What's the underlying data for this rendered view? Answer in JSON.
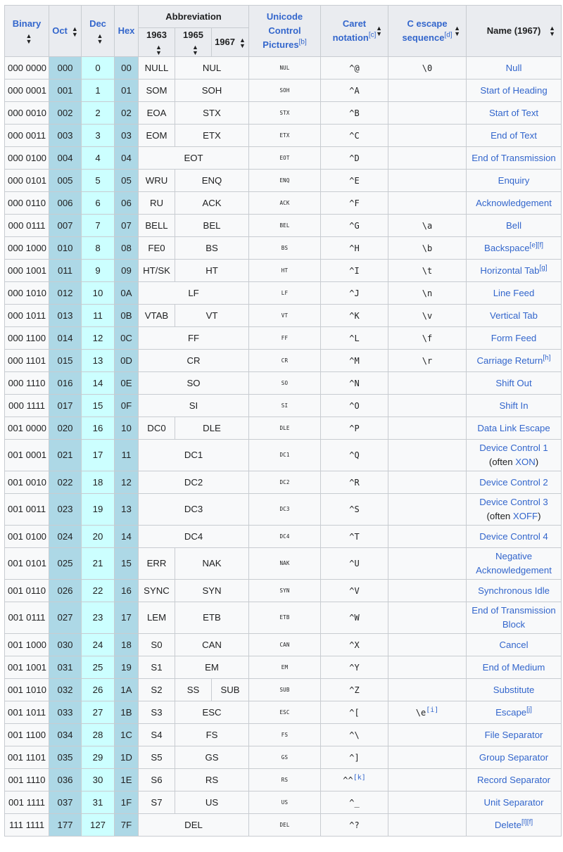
{
  "header": {
    "binary": "Binary",
    "oct": "Oct",
    "dec": "Dec",
    "hex": "Hex",
    "abbreviation": "Abbreviation",
    "y1963": "1963",
    "y1965": "1965",
    "y1967": "1967",
    "unicode_line1": "Unicode",
    "unicode_line2": "Control",
    "unicode_line3": "Pictures",
    "unicode_note": "[b]",
    "caret_line1": "Caret",
    "caret_line2": "notation",
    "caret_note": "[c]",
    "cesc_line1": "C escape",
    "cesc_line2": "sequence",
    "cesc_note": "[d]",
    "name": "Name (1967)",
    "sort_icon": "sort-arrows-icon"
  },
  "colors": {
    "link": "#3366cc",
    "oct_hex_bg": "#add8e6",
    "dec_bg": "#ccffff",
    "header_bg": "#eaecf0",
    "cell_bg": "#f8f9fa",
    "border": "#c8ccd1"
  },
  "rows": [
    {
      "bin": "000 0000",
      "oct": "000",
      "dec": "0",
      "hex": "00",
      "a63": "NULL",
      "a65": "NUL",
      "a67": "",
      "pic": "NUL",
      "caret": "^@",
      "caret_note": "",
      "cesc": "\\0",
      "cesc_note": "",
      "name": "Null",
      "name_note": "",
      "name2": "",
      "name2_pre": "",
      "name2_link": "",
      "name2_post": ""
    },
    {
      "bin": "000 0001",
      "oct": "001",
      "dec": "1",
      "hex": "01",
      "a63": "SOM",
      "a65": "SOH",
      "pic": "SOH",
      "caret": "^A",
      "cesc": "",
      "name": "Start of Heading"
    },
    {
      "bin": "000 0010",
      "oct": "002",
      "dec": "2",
      "hex": "02",
      "a63": "EOA",
      "a65": "STX",
      "pic": "STX",
      "caret": "^B",
      "cesc": "",
      "name": "Start of Text"
    },
    {
      "bin": "000 0011",
      "oct": "003",
      "dec": "3",
      "hex": "03",
      "a63": "EOM",
      "a65": "ETX",
      "pic": "ETX",
      "caret": "^C",
      "cesc": "",
      "name": "End of Text"
    },
    {
      "bin": "000 0100",
      "oct": "004",
      "dec": "4",
      "hex": "04",
      "all": "EOT",
      "pic": "EOT",
      "caret": "^D",
      "cesc": "",
      "name": "End of Transmission"
    },
    {
      "bin": "000 0101",
      "oct": "005",
      "dec": "5",
      "hex": "05",
      "a63": "WRU",
      "a65": "ENQ",
      "pic": "ENQ",
      "caret": "^E",
      "cesc": "",
      "name": "Enquiry"
    },
    {
      "bin": "000 0110",
      "oct": "006",
      "dec": "6",
      "hex": "06",
      "a63": "RU",
      "a65": "ACK",
      "pic": "ACK",
      "caret": "^F",
      "cesc": "",
      "name": "Acknowledgement"
    },
    {
      "bin": "000 0111",
      "oct": "007",
      "dec": "7",
      "hex": "07",
      "a63": "BELL",
      "a65": "BEL",
      "pic": "BEL",
      "caret": "^G",
      "cesc": "\\a",
      "name": "Bell"
    },
    {
      "bin": "000 1000",
      "oct": "010",
      "dec": "8",
      "hex": "08",
      "a63": "FE0",
      "a65": "BS",
      "pic": "BS",
      "caret": "^H",
      "cesc": "\\b",
      "name": "Backspace",
      "name_note": "[e][f]"
    },
    {
      "bin": "000 1001",
      "oct": "011",
      "dec": "9",
      "hex": "09",
      "a63": "HT/SK",
      "a65": "HT",
      "pic": "HT",
      "caret": "^I",
      "cesc": "\\t",
      "name": "Horizontal Tab",
      "name_note": "[g]"
    },
    {
      "bin": "000 1010",
      "oct": "012",
      "dec": "10",
      "hex": "0A",
      "all": "LF",
      "pic": "LF",
      "caret": "^J",
      "cesc": "\\n",
      "name": "Line Feed"
    },
    {
      "bin": "000 1011",
      "oct": "013",
      "dec": "11",
      "hex": "0B",
      "a63": "VTAB",
      "a65": "VT",
      "pic": "VT",
      "caret": "^K",
      "cesc": "\\v",
      "name": "Vertical Tab"
    },
    {
      "bin": "000 1100",
      "oct": "014",
      "dec": "12",
      "hex": "0C",
      "all": "FF",
      "pic": "FF",
      "caret": "^L",
      "cesc": "\\f",
      "name": "Form Feed"
    },
    {
      "bin": "000 1101",
      "oct": "015",
      "dec": "13",
      "hex": "0D",
      "all": "CR",
      "pic": "CR",
      "caret": "^M",
      "cesc": "\\r",
      "name": "Carriage Return",
      "name_note": "[h]"
    },
    {
      "bin": "000 1110",
      "oct": "016",
      "dec": "14",
      "hex": "0E",
      "all": "SO",
      "pic": "SO",
      "caret": "^N",
      "cesc": "",
      "name": "Shift Out"
    },
    {
      "bin": "000 1111",
      "oct": "017",
      "dec": "15",
      "hex": "0F",
      "all": "SI",
      "pic": "SI",
      "caret": "^O",
      "cesc": "",
      "name": "Shift In"
    },
    {
      "bin": "001 0000",
      "oct": "020",
      "dec": "16",
      "hex": "10",
      "a63": "DC0",
      "a65": "DLE",
      "pic": "DLE",
      "caret": "^P",
      "cesc": "",
      "name": "Data Link Escape"
    },
    {
      "bin": "001 0001",
      "oct": "021",
      "dec": "17",
      "hex": "11",
      "all": "DC1",
      "pic": "DC1",
      "caret": "^Q",
      "cesc": "",
      "name": "Device Control 1",
      "name2_pre": "(often ",
      "name2_link": "XON",
      "name2_post": ")"
    },
    {
      "bin": "001 0010",
      "oct": "022",
      "dec": "18",
      "hex": "12",
      "all": "DC2",
      "pic": "DC2",
      "caret": "^R",
      "cesc": "",
      "name": "Device Control 2"
    },
    {
      "bin": "001 0011",
      "oct": "023",
      "dec": "19",
      "hex": "13",
      "all": "DC3",
      "pic": "DC3",
      "caret": "^S",
      "cesc": "",
      "name": "Device Control 3",
      "name2_pre": "(often ",
      "name2_link": "XOFF",
      "name2_post": ")"
    },
    {
      "bin": "001 0100",
      "oct": "024",
      "dec": "20",
      "hex": "14",
      "all": "DC4",
      "pic": "DC4",
      "caret": "^T",
      "cesc": "",
      "name": "Device Control 4"
    },
    {
      "bin": "001 0101",
      "oct": "025",
      "dec": "21",
      "hex": "15",
      "a63": "ERR",
      "a65": "NAK",
      "pic": "NAK",
      "caret": "^U",
      "cesc": "",
      "name": "Negative",
      "name2_link": "Acknowledgement"
    },
    {
      "bin": "001 0110",
      "oct": "026",
      "dec": "22",
      "hex": "16",
      "a63": "SYNC",
      "a65": "SYN",
      "pic": "SYN",
      "caret": "^V",
      "cesc": "",
      "name": "Synchronous Idle"
    },
    {
      "bin": "001 0111",
      "oct": "027",
      "dec": "23",
      "hex": "17",
      "a63": "LEM",
      "a65": "ETB",
      "pic": "ETB",
      "caret": "^W",
      "cesc": "",
      "name": "End of Transmission",
      "name2_link": "Block"
    },
    {
      "bin": "001 1000",
      "oct": "030",
      "dec": "24",
      "hex": "18",
      "a63": "S0",
      "a65": "CAN",
      "pic": "CAN",
      "caret": "^X",
      "cesc": "",
      "name": "Cancel"
    },
    {
      "bin": "001 1001",
      "oct": "031",
      "dec": "25",
      "hex": "19",
      "a63": "S1",
      "a65": "EM",
      "pic": "EM",
      "caret": "^Y",
      "cesc": "",
      "name": "End of Medium"
    },
    {
      "bin": "001 1010",
      "oct": "032",
      "dec": "26",
      "hex": "1A",
      "a63": "S2",
      "a65": "SS",
      "a67": "SUB",
      "pic": "SUB",
      "caret": "^Z",
      "cesc": "",
      "name": "Substitute"
    },
    {
      "bin": "001 1011",
      "oct": "033",
      "dec": "27",
      "hex": "1B",
      "a63": "S3",
      "a65": "ESC",
      "pic": "ESC",
      "caret": "^[",
      "cesc": "\\e",
      "cesc_note": "[i]",
      "name": "Escape",
      "name_note": "[j]"
    },
    {
      "bin": "001 1100",
      "oct": "034",
      "dec": "28",
      "hex": "1C",
      "a63": "S4",
      "a65": "FS",
      "pic": "FS",
      "caret": "^\\",
      "cesc": "",
      "name": "File Separator"
    },
    {
      "bin": "001 1101",
      "oct": "035",
      "dec": "29",
      "hex": "1D",
      "a63": "S5",
      "a65": "GS",
      "pic": "GS",
      "caret": "^]",
      "cesc": "",
      "name": "Group Separator"
    },
    {
      "bin": "001 1110",
      "oct": "036",
      "dec": "30",
      "hex": "1E",
      "a63": "S6",
      "a65": "RS",
      "pic": "RS",
      "caret": "^^",
      "caret_note": "[k]",
      "cesc": "",
      "name": "Record Separator"
    },
    {
      "bin": "001 1111",
      "oct": "037",
      "dec": "31",
      "hex": "1F",
      "a63": "S7",
      "a65": "US",
      "pic": "US",
      "caret": "^_",
      "cesc": "",
      "name": "Unit Separator"
    },
    {
      "bin": "111 1111",
      "oct": "177",
      "dec": "127",
      "hex": "7F",
      "all": "DEL",
      "pic": "DEL",
      "caret": "^?",
      "cesc": "",
      "name": "Delete",
      "name_note": "[l][f]"
    }
  ]
}
